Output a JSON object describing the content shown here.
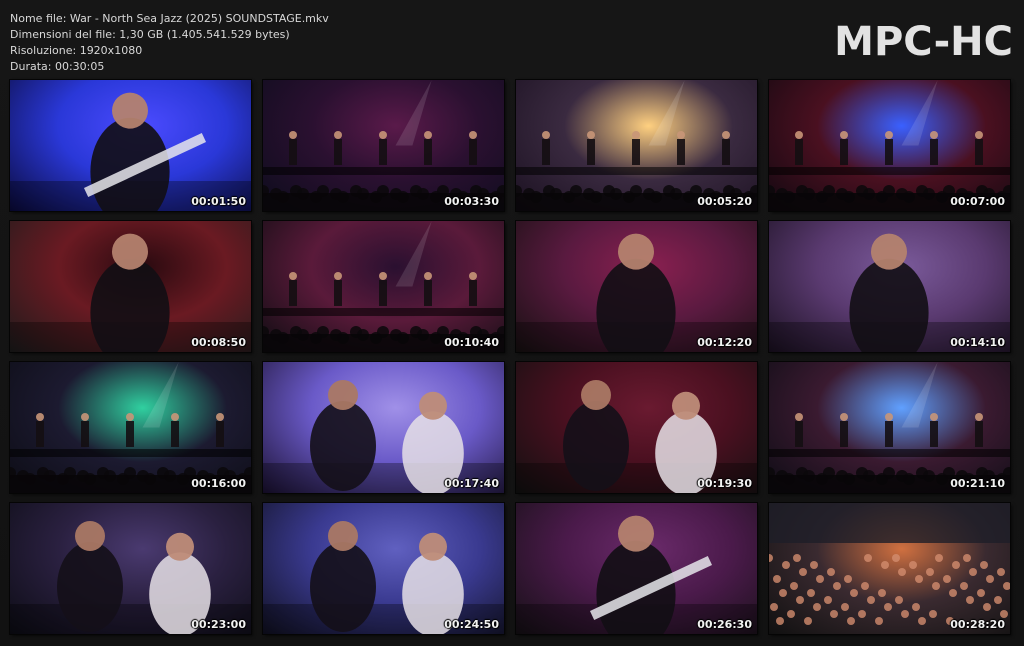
{
  "file_info": {
    "name_line": "Nome file: War - North Sea Jazz (2025) SOUNDSTAGE.mkv",
    "size_line": "Dimensioni del file: 1,30 GB (1.405.541.529 bytes)",
    "resolution_line": "Risoluzione: 1920x1080",
    "duration_line": "Durata: 00:30:05"
  },
  "logo": "MPC-HC",
  "thumbnails": [
    {
      "time": "00:01:50",
      "scene": "bassist-closeup",
      "colors": [
        "#2a38d8",
        "#4b4bff",
        "#0a0a3a"
      ]
    },
    {
      "time": "00:03:30",
      "scene": "stage-wide",
      "colors": [
        "#2a1030",
        "#5a1a4a",
        "#0c0c1c"
      ]
    },
    {
      "time": "00:05:20",
      "scene": "stage-lights",
      "colors": [
        "#3a2a40",
        "#ffd080",
        "#1a1020"
      ]
    },
    {
      "time": "00:07:00",
      "scene": "stage-wide-blue",
      "colors": [
        "#4a1020",
        "#3a60ff",
        "#100810"
      ]
    },
    {
      "time": "00:08:50",
      "scene": "singer-harmonica",
      "colors": [
        "#6a1a22",
        "#2a0a10",
        "#1c1c1c"
      ]
    },
    {
      "time": "00:10:40",
      "scene": "stage-mid",
      "colors": [
        "#5a1a3a",
        "#2a1030",
        "#0c0c10"
      ]
    },
    {
      "time": "00:12:20",
      "scene": "singer-mic",
      "colors": [
        "#5a1a40",
        "#8a2050",
        "#151010"
      ]
    },
    {
      "time": "00:14:10",
      "scene": "singer-cap",
      "colors": [
        "#5a3a70",
        "#7a5a9a",
        "#1a1020"
      ]
    },
    {
      "time": "00:16:00",
      "scene": "stage-green",
      "colors": [
        "#1c1a30",
        "#30d0a0",
        "#0c0c14"
      ]
    },
    {
      "time": "00:17:40",
      "scene": "duo-purple",
      "colors": [
        "#6a5ac8",
        "#a090e8",
        "#1a1030"
      ]
    },
    {
      "time": "00:19:30",
      "scene": "band-closeup",
      "colors": [
        "#4a1020",
        "#6a1a30",
        "#101010"
      ]
    },
    {
      "time": "00:21:10",
      "scene": "sax-stage",
      "colors": [
        "#3a1a30",
        "#60a0ff",
        "#0c0c14"
      ]
    },
    {
      "time": "00:23:00",
      "scene": "two-singers",
      "colors": [
        "#2a2040",
        "#4a3a70",
        "#0c0c14"
      ]
    },
    {
      "time": "00:24:50",
      "scene": "harmonica-duo",
      "colors": [
        "#3a3a90",
        "#6060c0",
        "#101020"
      ]
    },
    {
      "time": "00:26:30",
      "scene": "guitar-closeup",
      "colors": [
        "#4a1a4a",
        "#6a2a6a",
        "#141014"
      ]
    },
    {
      "time": "00:28:20",
      "scene": "arena-crowd",
      "colors": [
        "#3a2a30",
        "#d07040",
        "#101010"
      ]
    }
  ]
}
